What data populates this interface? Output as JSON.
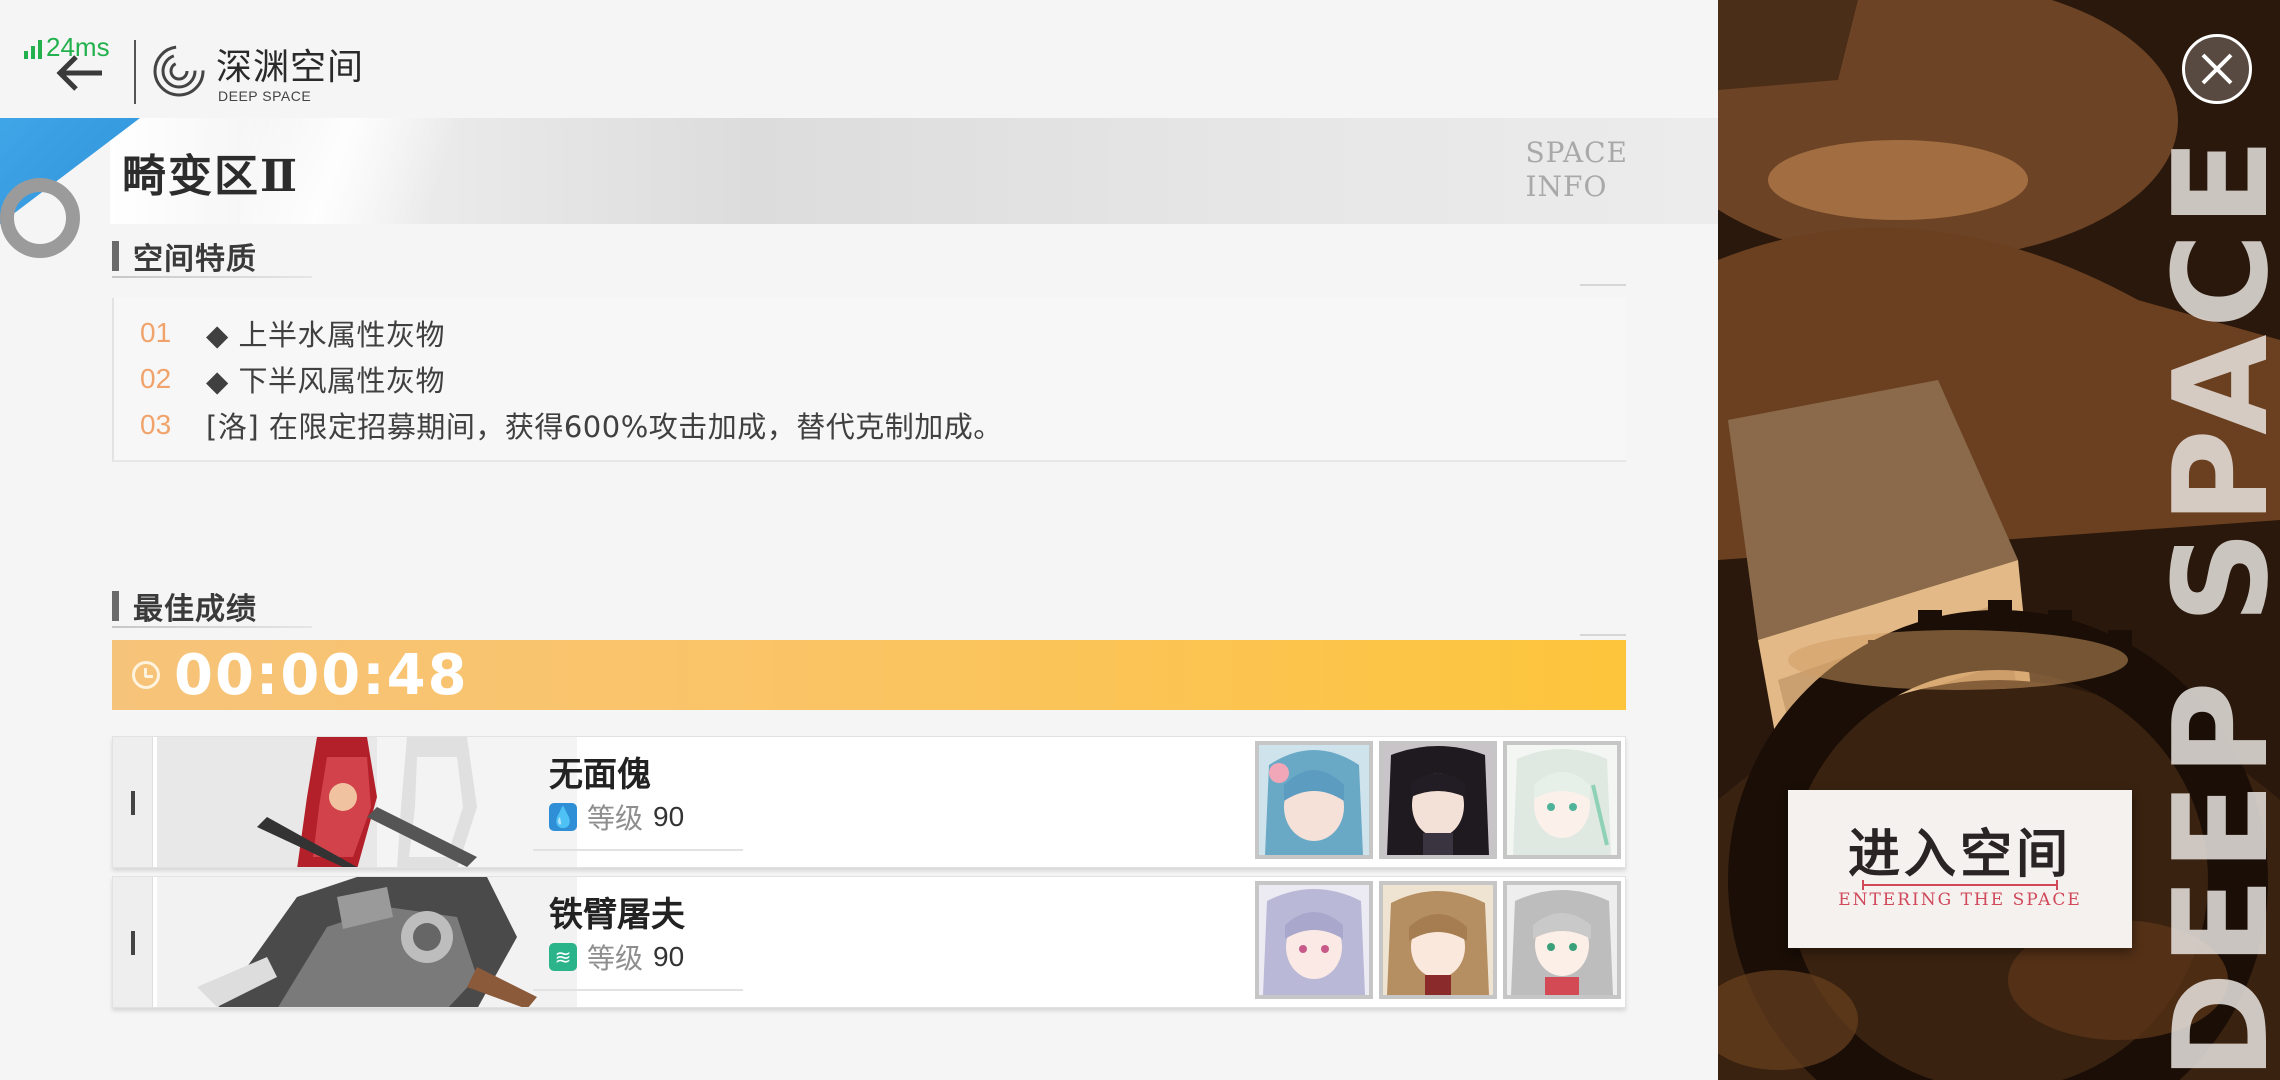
{
  "status": {
    "ping": "24ms"
  },
  "header": {
    "title": "深渊空间",
    "subtitle": "DEEP SPACE"
  },
  "banner": {
    "zone_title": "畸变区Ⅱ",
    "info_line1": "SPACE",
    "info_line2": "INFO"
  },
  "traits": {
    "heading": "空间特质",
    "items": [
      {
        "num": "01",
        "text": "◆ 上半水属性灰物"
      },
      {
        "num": "02",
        "text": "◆ 下半风属性灰物"
      },
      {
        "num": "03",
        "text": "[洛] 在限定招募期间，获得600%攻击加成，替代克制加成。"
      }
    ]
  },
  "best": {
    "heading": "最佳成绩",
    "time": "00:00:48"
  },
  "enemies": [
    {
      "name": "无面傀",
      "level_label": "等级",
      "level": "90",
      "element": "water",
      "element_color": "#2f8fd6"
    },
    {
      "name": "铁臂屠夫",
      "level_label": "等级",
      "level": "90",
      "element": "wind",
      "element_color": "#2bb38a"
    }
  ],
  "enter_button": {
    "label": "进入空间",
    "sub": "ENTERING THE SPACE"
  },
  "art_text": "DEEP SPACE",
  "colors": {
    "accent_blue": "#2f92d8",
    "trait_number": "#f0a36b",
    "time_bar": "#fdc53b",
    "enter_sub": "#d0485a"
  }
}
